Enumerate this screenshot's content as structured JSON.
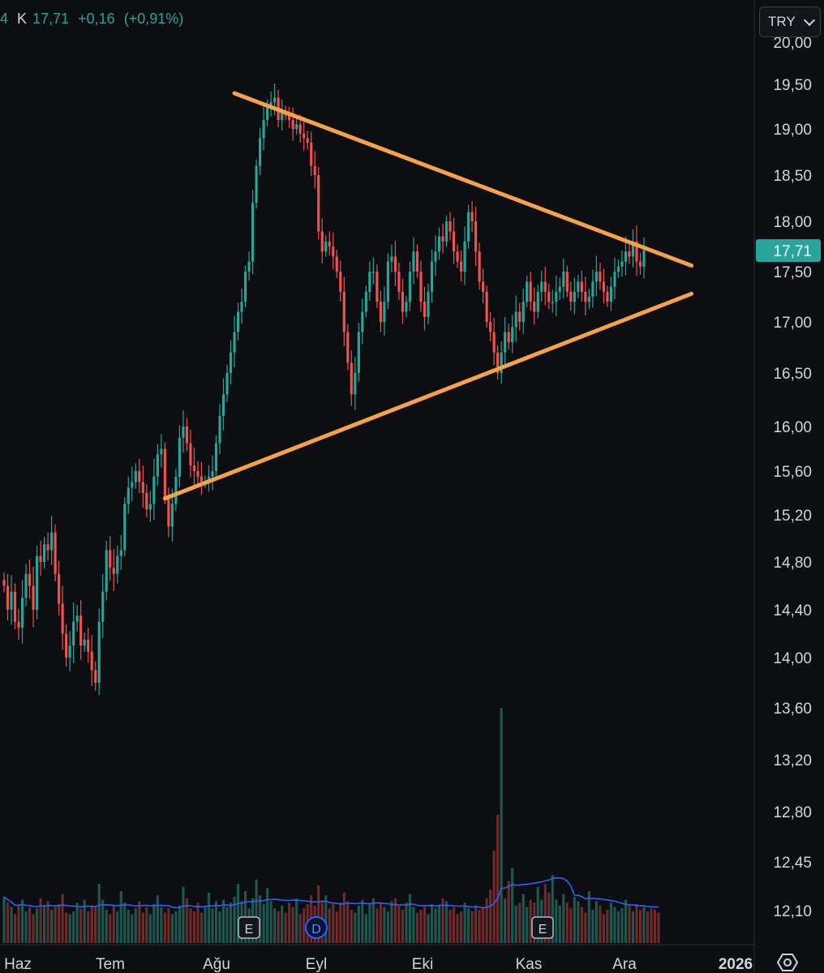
{
  "header": {
    "prefix": "4",
    "close_label": "K",
    "close_value": "17,71",
    "change": "+0,16",
    "change_pct": "(+0,91%)"
  },
  "currency": {
    "label": "TRY",
    "icon": "chevron-down-icon"
  },
  "settings": {
    "icon": "gear-icon"
  },
  "colors": {
    "background": "#0d0e12",
    "up": "#26a69a",
    "down": "#ef5350",
    "trendline": "#f7a24a",
    "volume_ma": "#2962ff",
    "axis_text": "#d1d4dc",
    "price_badge": "#26a69a"
  },
  "chart_data": {
    "type": "candlestick",
    "price_axis": {
      "ticks": [
        "20,00",
        "19,50",
        "19,00",
        "18,50",
        "18,00",
        "17,50",
        "17,00",
        "16,50",
        "16,00",
        "15,60",
        "15,20",
        "14,80",
        "14,40",
        "14,00",
        "13,60",
        "13,20",
        "12,80",
        "12,45",
        "12,10"
      ],
      "last_price_label": "17,71",
      "last_price": 17.71
    },
    "time_axis": {
      "ticks": [
        "Haz",
        "Tem",
        "Ağu",
        "Eyl",
        "Eki",
        "Kas",
        "Ara",
        "2026"
      ]
    },
    "event_markers": [
      {
        "label": "E",
        "period": "Ağu (mid)"
      },
      {
        "label": "D",
        "period": "Eyl (early)"
      },
      {
        "label": "E",
        "period": "Kas (mid)"
      }
    ],
    "closes": [
      14.6,
      14.4,
      14.55,
      14.3,
      14.25,
      14.5,
      14.7,
      14.6,
      14.4,
      14.85,
      14.8,
      14.95,
      14.9,
      15.05,
      14.7,
      14.45,
      14.2,
      14.0,
      14.1,
      14.3,
      14.35,
      14.1,
      14.15,
      14.05,
      13.9,
      13.8,
      14.3,
      14.55,
      14.9,
      14.75,
      14.7,
      14.85,
      14.9,
      15.3,
      15.45,
      15.5,
      15.6,
      15.5,
      15.4,
      15.25,
      15.3,
      15.55,
      15.75,
      15.8,
      15.35,
      15.1,
      15.3,
      15.55,
      15.9,
      16.0,
      15.85,
      15.65,
      15.6,
      15.55,
      15.5,
      15.5,
      15.55,
      15.6,
      15.85,
      16.1,
      16.3,
      16.5,
      16.7,
      16.9,
      17.1,
      17.2,
      17.5,
      17.6,
      18.2,
      18.6,
      18.9,
      19.1,
      19.25,
      19.3,
      19.35,
      19.1,
      19.2,
      19.15,
      19.1,
      19.0,
      19.05,
      18.95,
      18.9,
      18.85,
      18.6,
      18.5,
      17.9,
      17.7,
      17.8,
      17.75,
      17.65,
      17.5,
      17.3,
      16.9,
      16.6,
      16.3,
      16.5,
      16.9,
      17.1,
      17.3,
      17.5,
      17.5,
      17.2,
      17.0,
      17.2,
      17.6,
      17.65,
      17.5,
      17.3,
      17.1,
      17.2,
      17.5,
      17.7,
      17.5,
      17.2,
      17.05,
      17.3,
      17.6,
      17.7,
      17.85,
      17.8,
      18.0,
      17.9,
      17.7,
      17.6,
      17.5,
      17.8,
      18.1,
      18.0,
      17.7,
      17.4,
      17.3,
      17.0,
      16.9,
      16.7,
      16.5,
      16.7,
      16.9,
      16.8,
      16.95,
      17.1,
      17.0,
      17.2,
      17.4,
      17.2,
      17.1,
      17.3,
      17.4,
      17.3,
      17.2,
      17.2,
      17.3,
      17.35,
      17.5,
      17.3,
      17.2,
      17.3,
      17.4,
      17.3,
      17.2,
      17.25,
      17.4,
      17.5,
      17.4,
      17.3,
      17.2,
      17.35,
      17.5,
      17.55,
      17.6,
      17.7,
      17.65,
      17.8,
      17.6,
      17.55,
      17.71
    ],
    "volumes": [
      3.2,
      2.8,
      2.5,
      2.0,
      2.6,
      3.0,
      2.2,
      2.5,
      2.0,
      2.4,
      3.1,
      2.6,
      2.9,
      2.3,
      2.5,
      2.7,
      3.4,
      2.1,
      2.0,
      2.2,
      2.8,
      2.4,
      3.0,
      2.2,
      2.6,
      2.5,
      4.1,
      3.0,
      2.3,
      2.0,
      2.6,
      2.2,
      3.6,
      2.8,
      2.3,
      2.0,
      2.4,
      2.9,
      2.1,
      2.5,
      2.0,
      2.7,
      3.3,
      2.5,
      2.1,
      2.4,
      2.0,
      2.2,
      2.6,
      3.9,
      3.1,
      2.4,
      2.2,
      2.8,
      2.1,
      2.5,
      3.5,
      2.4,
      2.9,
      2.2,
      3.0,
      2.5,
      2.8,
      3.2,
      4.1,
      2.9,
      3.6,
      2.4,
      3.1,
      4.4,
      3.3,
      2.7,
      3.8,
      2.9,
      2.4,
      2.2,
      2.6,
      2.1,
      2.8,
      2.5,
      3.1,
      2.0,
      2.4,
      2.7,
      3.3,
      2.6,
      4.0,
      2.9,
      3.3,
      2.4,
      2.7,
      2.2,
      2.8,
      3.5,
      2.9,
      2.3,
      2.1,
      2.6,
      3.0,
      2.0,
      2.7,
      3.1,
      2.4,
      2.8,
      2.5,
      2.2,
      2.9,
      3.1,
      2.6,
      2.3,
      2.8,
      3.4,
      2.5,
      2.1,
      2.3,
      2.5,
      2.0,
      2.7,
      2.4,
      2.6,
      3.1,
      2.9,
      2.3,
      2.5,
      2.0,
      2.2,
      2.8,
      2.4,
      2.2,
      2.6,
      2.3,
      2.5,
      3.1,
      3.7,
      6.4,
      8.9,
      16.3,
      3.1,
      4.3,
      5.2,
      2.6,
      2.8,
      3.4,
      2.5,
      3.0,
      2.8,
      3.9,
      3.0,
      4.1,
      3.5,
      4.7,
      3.0,
      2.6,
      3.4,
      2.8,
      2.4,
      3.2,
      2.9,
      2.5,
      2.1,
      3.6,
      2.3,
      2.9,
      2.6,
      2.0,
      2.3,
      2.8,
      2.5,
      2.2,
      2.4,
      3.0,
      2.6,
      2.2,
      2.7,
      2.3,
      2.5,
      2.2,
      2.4,
      2.3,
      2.1
    ],
    "volume_ma_visible": true,
    "trendlines": [
      {
        "name": "upper",
        "from": {
          "bar": 63,
          "price": 19.4
        },
        "to": {
          "bar": 188,
          "price": 17.56
        }
      },
      {
        "name": "lower",
        "from": {
          "bar": 44,
          "price": 15.35
        },
        "to": {
          "bar": 188,
          "price": 17.28
        }
      }
    ],
    "grid": false
  }
}
